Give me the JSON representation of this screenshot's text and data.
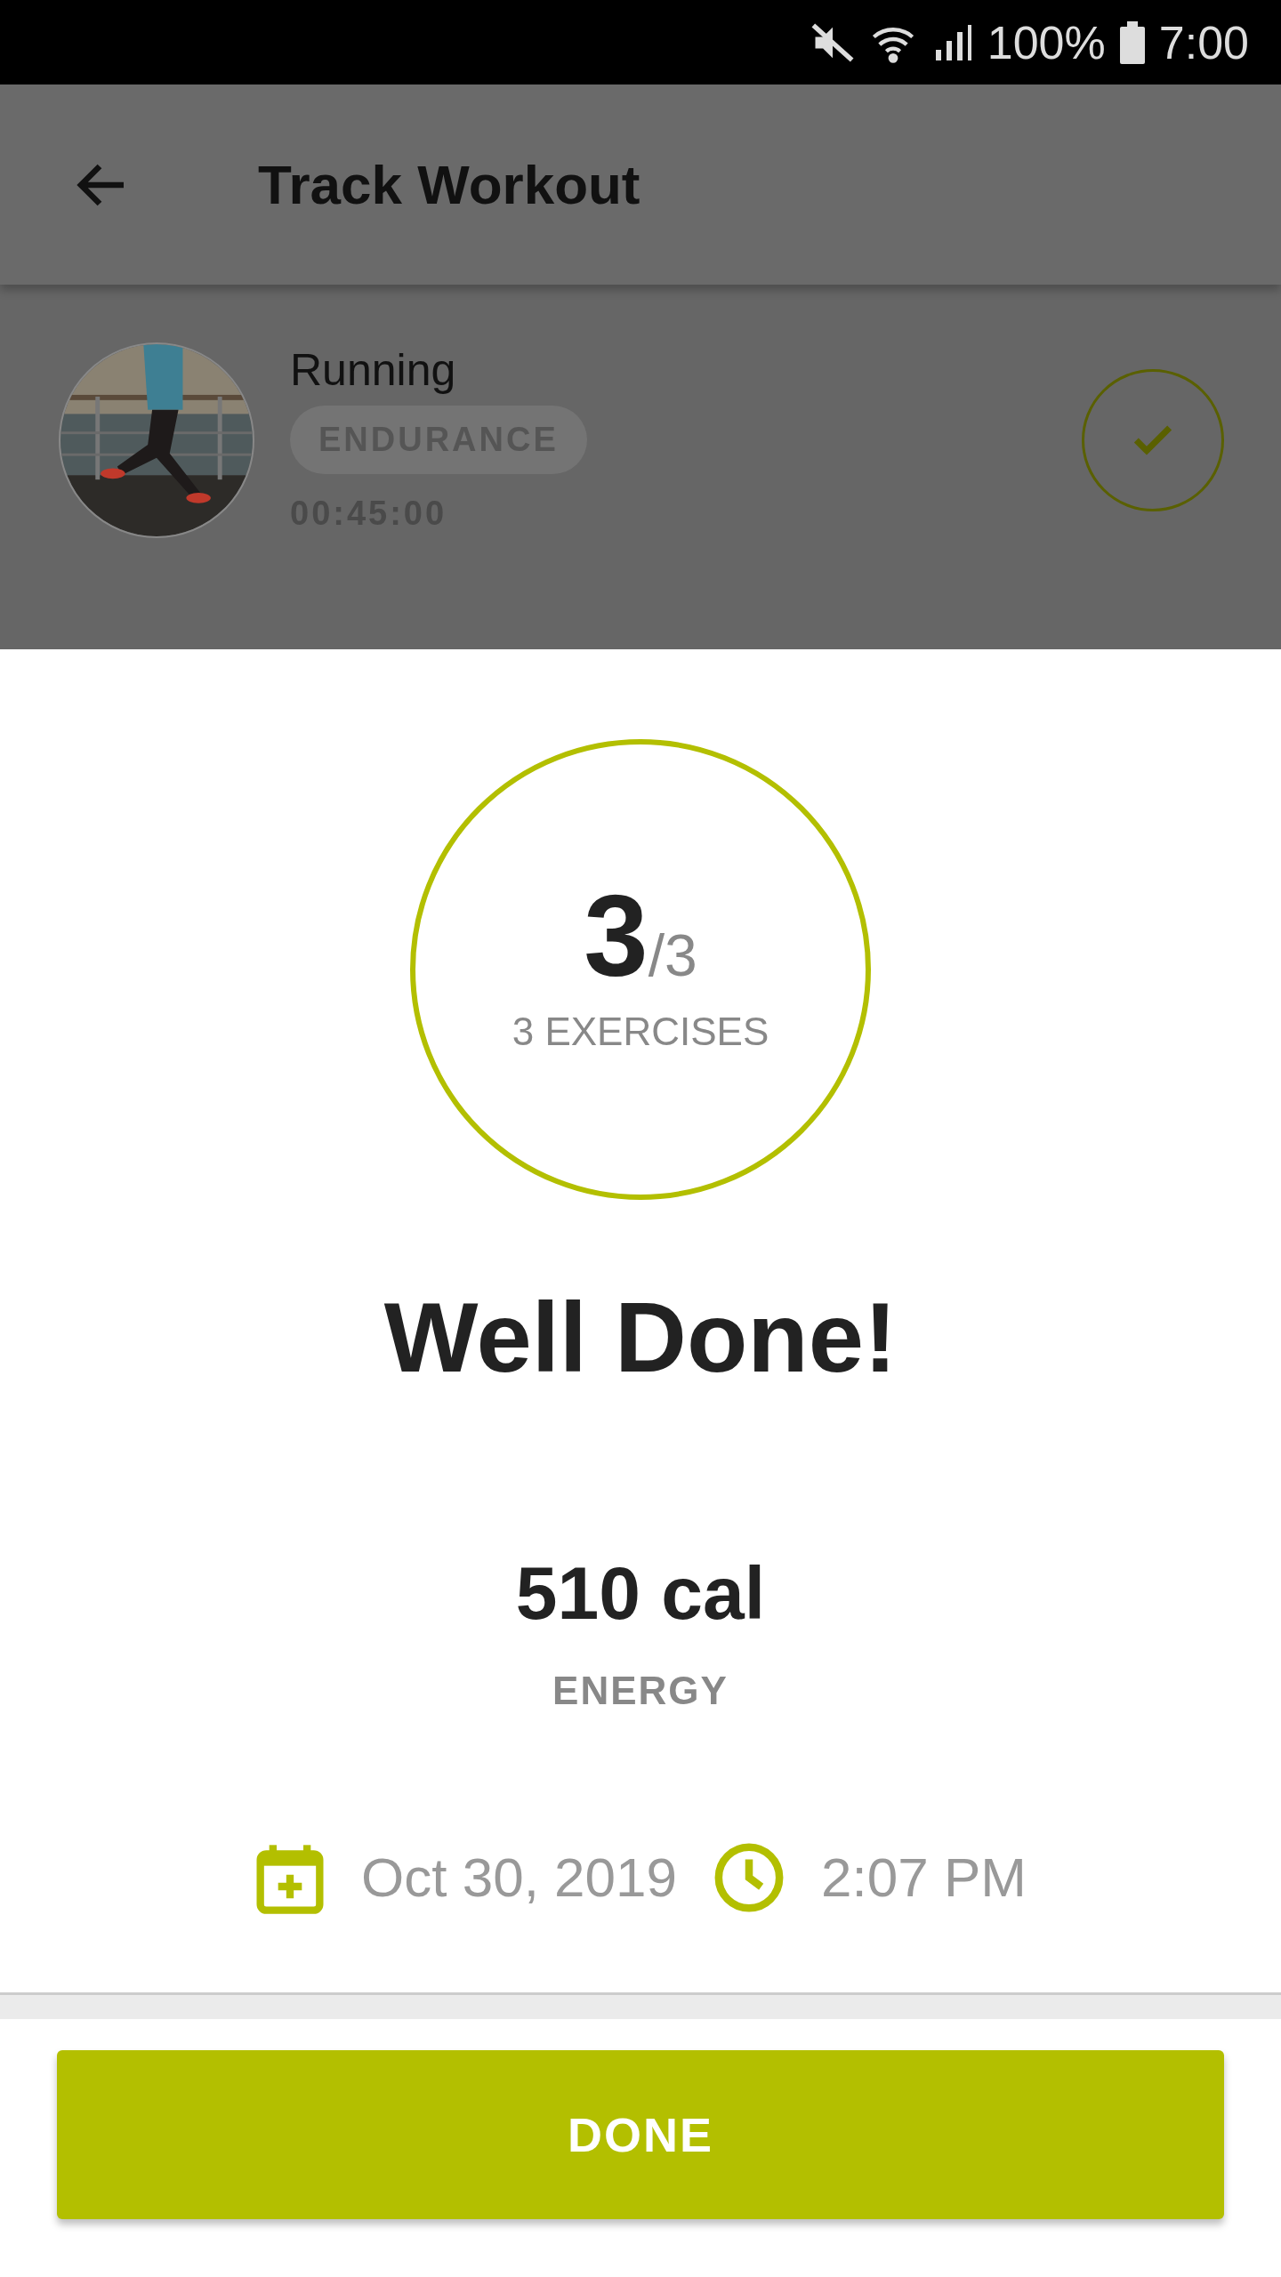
{
  "status_bar": {
    "battery": "100%",
    "time": "7:00"
  },
  "app_bar": {
    "title": "Track Workout"
  },
  "workout": {
    "name": "Running",
    "tag": "ENDURANCE",
    "duration": "00:45:00",
    "completed": true
  },
  "summary": {
    "done": "3",
    "total": "/3",
    "caption": "3 EXERCISES",
    "headline": "Well Done!",
    "energy": "510 cal",
    "energy_label": "ENERGY",
    "date": "Oct 30, 2019",
    "time": "2:07 PM"
  },
  "buttons": [
    "DONE"
  ]
}
